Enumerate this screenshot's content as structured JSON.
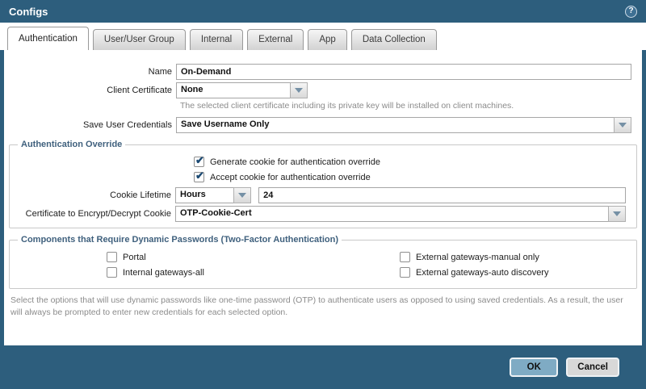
{
  "dialog": {
    "title": "Configs"
  },
  "tabs": [
    {
      "label": "Authentication",
      "active": true
    },
    {
      "label": "User/User Group",
      "active": false
    },
    {
      "label": "Internal",
      "active": false
    },
    {
      "label": "External",
      "active": false
    },
    {
      "label": "App",
      "active": false
    },
    {
      "label": "Data Collection",
      "active": false
    }
  ],
  "form": {
    "name": {
      "label": "Name",
      "value": "On-Demand"
    },
    "client_certificate": {
      "label": "Client Certificate",
      "value": "None",
      "help": "The selected client certificate including its private key will be installed on client machines."
    },
    "save_user_credentials": {
      "label": "Save User Credentials",
      "value": "Save Username Only"
    }
  },
  "auth_override": {
    "legend": "Authentication Override",
    "generate_cookie": {
      "label": "Generate cookie for authentication override",
      "checked": true
    },
    "accept_cookie": {
      "label": "Accept cookie for authentication override",
      "checked": true
    },
    "cookie_lifetime": {
      "label": "Cookie Lifetime",
      "unit": "Hours",
      "value": "24"
    },
    "cookie_cert": {
      "label": "Certificate to Encrypt/Decrypt Cookie",
      "value": "OTP-Cookie-Cert"
    }
  },
  "components": {
    "legend": "Components that Require Dynamic Passwords (Two-Factor Authentication)",
    "options": [
      {
        "label": "Portal",
        "checked": false
      },
      {
        "label": "Internal gateways-all",
        "checked": false
      },
      {
        "label": "External gateways-manual only",
        "checked": false
      },
      {
        "label": "External gateways-auto discovery",
        "checked": false
      }
    ]
  },
  "footer": {
    "note": "Select the options that will use dynamic passwords like one-time password (OTP) to authenticate users as opposed to using saved credentials. As a result, the user will always be prompted to enter new credentials for each selected option.",
    "ok_label": "OK",
    "cancel_label": "Cancel"
  },
  "colors": {
    "titlebar": "#2d5e7d",
    "check": "#1c4a73",
    "ok_button": "#7fabc4",
    "legend_text": "#3f607d"
  }
}
